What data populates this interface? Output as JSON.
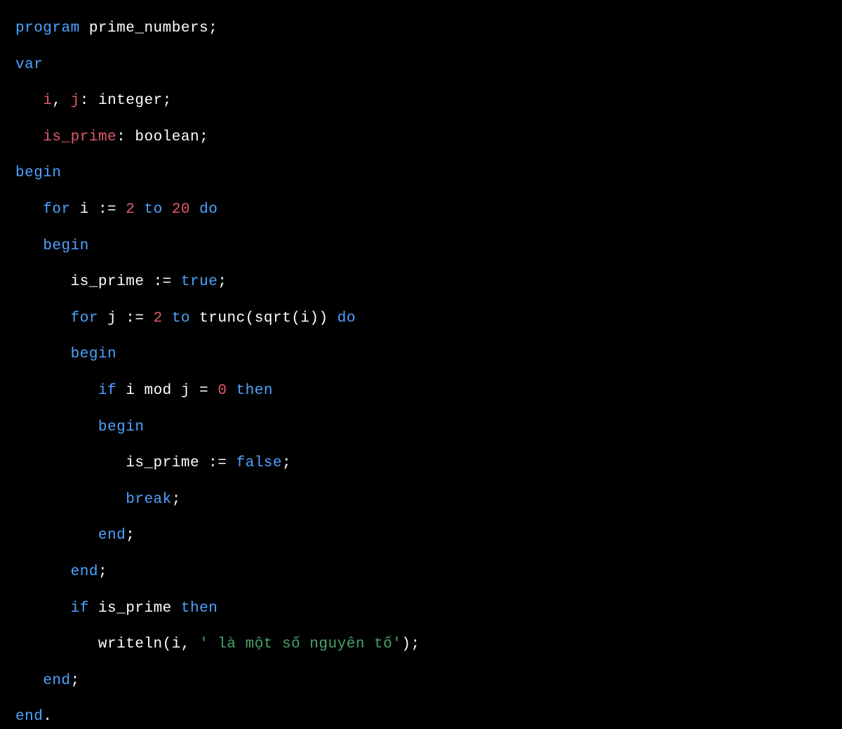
{
  "language": "Pascal",
  "lines": {
    "l1": {
      "program_kw": "program",
      "name": "prime_numbers",
      "semi": ";"
    },
    "l2": {
      "var_kw": "var"
    },
    "l3": {
      "indent": "   ",
      "i": "i",
      "comma": ", ",
      "j": "j",
      "colon": ": ",
      "type": "integer",
      "semi": ";"
    },
    "l4": {
      "indent": "   ",
      "name": "is_prime",
      "colon": ": ",
      "type": "boolean",
      "semi": ";"
    },
    "l5": {
      "begin_kw": "begin"
    },
    "l6": {
      "indent": "   ",
      "for_kw": "for",
      "sp1": " ",
      "i": "i",
      "sp2": " ",
      "assign": ":=",
      "sp3": " ",
      "n2": "2",
      "sp4": " ",
      "to_kw": "to",
      "sp5": " ",
      "n20": "20",
      "sp6": " ",
      "do_kw": "do"
    },
    "l7": {
      "indent": "   ",
      "begin_kw": "begin"
    },
    "l8": {
      "indent": "      ",
      "name": "is_prime",
      "sp1": " ",
      "assign": ":=",
      "sp2": " ",
      "val": "true",
      "semi": ";"
    },
    "l9": {
      "indent": "      ",
      "for_kw": "for",
      "sp1": " ",
      "j": "j",
      "sp2": " ",
      "assign": ":=",
      "sp3": " ",
      "n2": "2",
      "sp4": " ",
      "to_kw": "to",
      "sp5": " ",
      "trunc": "trunc",
      "op1": "(",
      "sqrt": "sqrt",
      "op2": "(",
      "i": "i",
      "cp2": ")",
      "cp1": ")",
      "sp6": " ",
      "do_kw": "do"
    },
    "l10": {
      "indent": "      ",
      "begin_kw": "begin"
    },
    "l11": {
      "indent": "         ",
      "if_kw": "if",
      "sp1": " ",
      "i": "i",
      "sp2": " ",
      "mod_kw": "mod",
      "sp3": " ",
      "j": "j",
      "sp4": " ",
      "eq": "=",
      "sp5": " ",
      "n0": "0",
      "sp6": " ",
      "then_kw": "then"
    },
    "l12": {
      "indent": "         ",
      "begin_kw": "begin"
    },
    "l13": {
      "indent": "            ",
      "name": "is_prime",
      "sp1": " ",
      "assign": ":=",
      "sp2": " ",
      "val": "false",
      "semi": ";"
    },
    "l14": {
      "indent": "            ",
      "break_kw": "break",
      "semi": ";"
    },
    "l15": {
      "indent": "         ",
      "end_kw": "end",
      "semi": ";"
    },
    "l16": {
      "indent": "      ",
      "end_kw": "end",
      "semi": ";"
    },
    "l17": {
      "indent": "      ",
      "if_kw": "if",
      "sp1": " ",
      "name": "is_prime",
      "sp2": " ",
      "then_kw": "then"
    },
    "l18": {
      "indent": "         ",
      "writeln": "writeln",
      "op": "(",
      "i": "i",
      "comma": ", ",
      "str": "' là một số nguyên tố'",
      "cp": ")",
      "semi": ";"
    },
    "l19": {
      "indent": "   ",
      "end_kw": "end",
      "semi": ";"
    },
    "l20": {
      "end_kw": "end",
      "dot": "."
    }
  }
}
